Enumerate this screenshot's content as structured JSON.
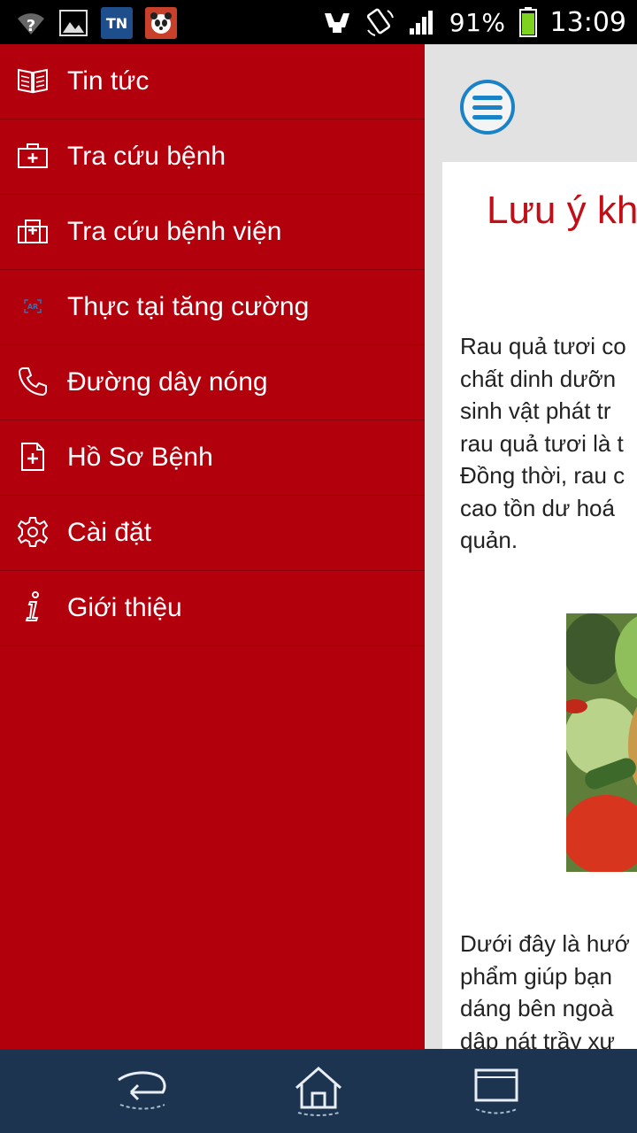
{
  "status_bar": {
    "battery_text": "91%",
    "time": "13:09",
    "icons": [
      "wifi-question-icon",
      "gallery-icon",
      "tn-app-icon",
      "panda-app-icon",
      "usb-debug-icon",
      "rotation-icon",
      "signal-icon",
      "battery-icon"
    ],
    "app_tn_label": "TN"
  },
  "drawer": {
    "items": [
      {
        "label": "Tin tức",
        "icon": "newspaper-icon"
      },
      {
        "label": "Tra cứu bệnh",
        "icon": "medical-kit-icon"
      },
      {
        "label": "Tra cứu bệnh viện",
        "icon": "hospital-icon"
      },
      {
        "label": "Thực tại tăng cường",
        "icon": "ar-icon"
      },
      {
        "label": "Đường dây nóng",
        "icon": "phone-icon"
      },
      {
        "label": "Hồ Sơ Bệnh",
        "icon": "medical-record-icon"
      },
      {
        "label": "Cài đặt",
        "icon": "gear-icon"
      },
      {
        "label": "Giới thiệu",
        "icon": "info-icon"
      }
    ]
  },
  "article": {
    "title": "Lưu ý kh",
    "paragraph1": [
      "Rau quả tươi co",
      "chất dinh dưỡn",
      "sinh vật phát tr",
      "rau quả tươi là t",
      "Đồng thời, rau c",
      "cao tồn dư hoá",
      "quản."
    ],
    "paragraph2": [
      "Dưới đây là hướ",
      "phẩm giúp bạn",
      "dáng bên ngoà",
      "dập nát trầy xư"
    ]
  },
  "bottom_bar": {
    "buttons": [
      "back-icon",
      "home-icon",
      "window-icon"
    ]
  },
  "colors": {
    "drawer_bg": "#b3000d",
    "title_red": "#c20e16",
    "accent_blue": "#1a82c6",
    "bottom_bar": "#1c3450"
  }
}
